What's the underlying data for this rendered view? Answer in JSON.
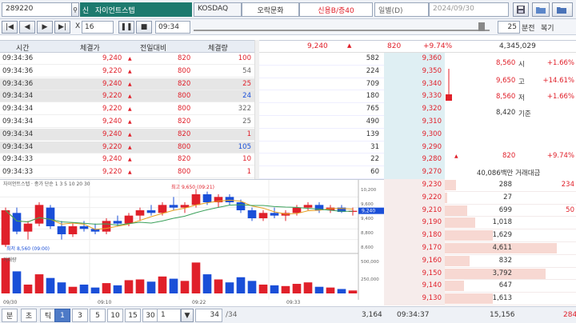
{
  "topbar": {
    "code": "289220",
    "market_tag": "신",
    "name": "자이언트스텝",
    "market": "KOSDAQ",
    "group": "오락문화",
    "credit": "신용B/증40",
    "period": "일별(D)",
    "date": "2024/09/30"
  },
  "toolbar": {
    "interval_x": "X",
    "interval_val": "16",
    "time": "09:34",
    "minute_val": "25",
    "minute_unit": "분전",
    "replay": "복기"
  },
  "table": {
    "headers": [
      "시간",
      "체결가",
      "전일대비",
      "체결량"
    ],
    "rows": [
      {
        "time": "09:34:36",
        "price": "9,240",
        "chg": "820",
        "vol": "100",
        "vc": "red",
        "hl": false
      },
      {
        "time": "09:34:36",
        "price": "9,220",
        "chg": "800",
        "vol": "54",
        "vc": "gray",
        "hl": false
      },
      {
        "time": "09:34:36",
        "price": "9,240",
        "chg": "820",
        "vol": "25",
        "vc": "red",
        "hl": true
      },
      {
        "time": "09:34:34",
        "price": "9,220",
        "chg": "800",
        "vol": "24",
        "vc": "blue",
        "hl": true
      },
      {
        "time": "09:34:34",
        "price": "9,220",
        "chg": "800",
        "vol": "322",
        "vc": "gray",
        "hl": false
      },
      {
        "time": "09:34:34",
        "price": "9,240",
        "chg": "820",
        "vol": "25",
        "vc": "gray",
        "hl": false
      },
      {
        "time": "09:34:34",
        "price": "9,240",
        "chg": "820",
        "vol": "1",
        "vc": "red",
        "hl": true
      },
      {
        "time": "09:34:34",
        "price": "9,220",
        "chg": "800",
        "vol": "105",
        "vc": "blue",
        "hl": true
      },
      {
        "time": "09:34:33",
        "price": "9,240",
        "chg": "820",
        "vol": "10",
        "vc": "red",
        "hl": false
      },
      {
        "time": "09:34:33",
        "price": "9,220",
        "chg": "800",
        "vol": "1",
        "vc": "red",
        "hl": false
      }
    ]
  },
  "summary": {
    "price": "9,240",
    "chg": "820",
    "rate": "+9.74%",
    "volume": "4,345,029"
  },
  "asks": [
    {
      "qty": "582",
      "price": "9,360",
      "w": 0.0
    },
    {
      "qty": "224",
      "price": "9,350",
      "w": 0.0
    },
    {
      "qty": "709",
      "price": "9,340",
      "w": 0.0
    },
    {
      "qty": "180",
      "price": "9,330",
      "w": 0.0
    },
    {
      "qty": "765",
      "price": "9,320",
      "w": 0.0
    },
    {
      "qty": "490",
      "price": "9,310",
      "w": 0.0
    },
    {
      "qty": "139",
      "price": "9,300",
      "w": 0.0
    },
    {
      "qty": "31",
      "price": "9,290",
      "w": 0.0
    },
    {
      "qty": "22",
      "price": "9,280",
      "w": 0.0
    },
    {
      "qty": "60",
      "price": "9,270",
      "w": 0.0
    }
  ],
  "info": [
    {
      "val": "8,560",
      "label": "시",
      "rate": "+1.66%"
    },
    {
      "val": "9,650",
      "label": "고",
      "rate": "+14.61%"
    },
    {
      "val": "8,560",
      "label": "저",
      "rate": "+1.66%"
    },
    {
      "val": "8,420",
      "label": "기준",
      "rate": ""
    }
  ],
  "info_chg": {
    "val": "820",
    "rate": "+9.74%"
  },
  "info_amt": "40,086백만 거래대금",
  "bids": [
    {
      "price": "9,230",
      "qty": "288",
      "w": 0.1,
      "extra": "234"
    },
    {
      "price": "9,220",
      "qty": "27",
      "w": 0.02,
      "extra": ""
    },
    {
      "price": "9,210",
      "qty": "699",
      "w": 0.2,
      "extra": "50"
    },
    {
      "price": "9,190",
      "qty": "1,018",
      "w": 0.27,
      "extra": ""
    },
    {
      "price": "9,180",
      "qty": "1,629",
      "w": 0.43,
      "extra": ""
    },
    {
      "price": "9,170",
      "qty": "4,611",
      "w": 1.0,
      "extra": ""
    },
    {
      "price": "9,160",
      "qty": "832",
      "w": 0.22,
      "extra": ""
    },
    {
      "price": "9,150",
      "qty": "3,792",
      "w": 0.9,
      "extra": ""
    },
    {
      "price": "9,140",
      "qty": "647",
      "w": 0.17,
      "extra": ""
    },
    {
      "price": "9,130",
      "qty": "1,613",
      "w": 0.43,
      "extra": ""
    }
  ],
  "chart": {
    "legend": "자이언트스텝 · 종가 단순 1 3 5 10 20 30",
    "high_label": "최고 9,650 (09:21)",
    "low_label": "최저 8,560 (09:00)",
    "vol_label": "거래량",
    "x_labels": [
      "09/30",
      "09:10",
      "09:22",
      "09:33"
    ],
    "y_labels": [
      "10,200",
      "9,600",
      "9,400",
      "8,800",
      "8,600"
    ],
    "vol_y": [
      "500,000",
      "250,000"
    ],
    "last_tag": "9,240"
  },
  "chart_data": {
    "type": "candlestick",
    "candles": [
      [
        8600,
        9300,
        8560,
        9250
      ],
      [
        9200,
        9300,
        8800,
        8850
      ],
      [
        8850,
        9050,
        8700,
        9000
      ],
      [
        9000,
        9400,
        8950,
        9350
      ],
      [
        9300,
        9350,
        8900,
        8950
      ],
      [
        8950,
        9050,
        8700,
        8800
      ],
      [
        8800,
        9000,
        8750,
        8950
      ],
      [
        8950,
        9050,
        8850,
        8900
      ],
      [
        8900,
        9000,
        8800,
        8850
      ],
      [
        8850,
        9100,
        8800,
        9050
      ],
      [
        9050,
        9150,
        8950,
        9000
      ],
      [
        9000,
        9200,
        8950,
        9150
      ],
      [
        9150,
        9300,
        9050,
        9250
      ],
      [
        9250,
        9350,
        9150,
        9200
      ],
      [
        9200,
        9400,
        9150,
        9350
      ],
      [
        9350,
        9500,
        9250,
        9300
      ],
      [
        9300,
        9400,
        9200,
        9350
      ],
      [
        9350,
        9650,
        9300,
        9550
      ],
      [
        9550,
        9600,
        9350,
        9400
      ],
      [
        9400,
        9550,
        9300,
        9500
      ],
      [
        9500,
        9550,
        9350,
        9400
      ],
      [
        9400,
        9450,
        9200,
        9250
      ],
      [
        9250,
        9300,
        9050,
        9100
      ],
      [
        9100,
        9250,
        9050,
        9200
      ],
      [
        9200,
        9300,
        9100,
        9150
      ],
      [
        9150,
        9250,
        9050,
        9200
      ],
      [
        9200,
        9350,
        9150,
        9300
      ],
      [
        9300,
        9400,
        9250,
        9350
      ],
      [
        9350,
        9400,
        9200,
        9250
      ],
      [
        9250,
        9350,
        9200,
        9300
      ],
      [
        9300,
        9350,
        9200,
        9220
      ],
      [
        9220,
        9300,
        9150,
        9240
      ]
    ],
    "volume": [
      480,
      300,
      120,
      260,
      210,
      150,
      90,
      120,
      80,
      140,
      110,
      180,
      190,
      160,
      230,
      200,
      170,
      420,
      260,
      190,
      150,
      220,
      170,
      120,
      110,
      100,
      130,
      150,
      90,
      80,
      60,
      40
    ]
  },
  "bottom": {
    "tabs": [
      "분",
      "초",
      "틱"
    ],
    "nums": [
      "1",
      "3",
      "5",
      "10",
      "15",
      "30"
    ],
    "sel_num": "1",
    "count": "1",
    "page": "34",
    "page_total": "/34",
    "ask_total": "3,164",
    "time": "09:34:37",
    "bid_total": "15,156",
    "bid_extra": "284"
  }
}
